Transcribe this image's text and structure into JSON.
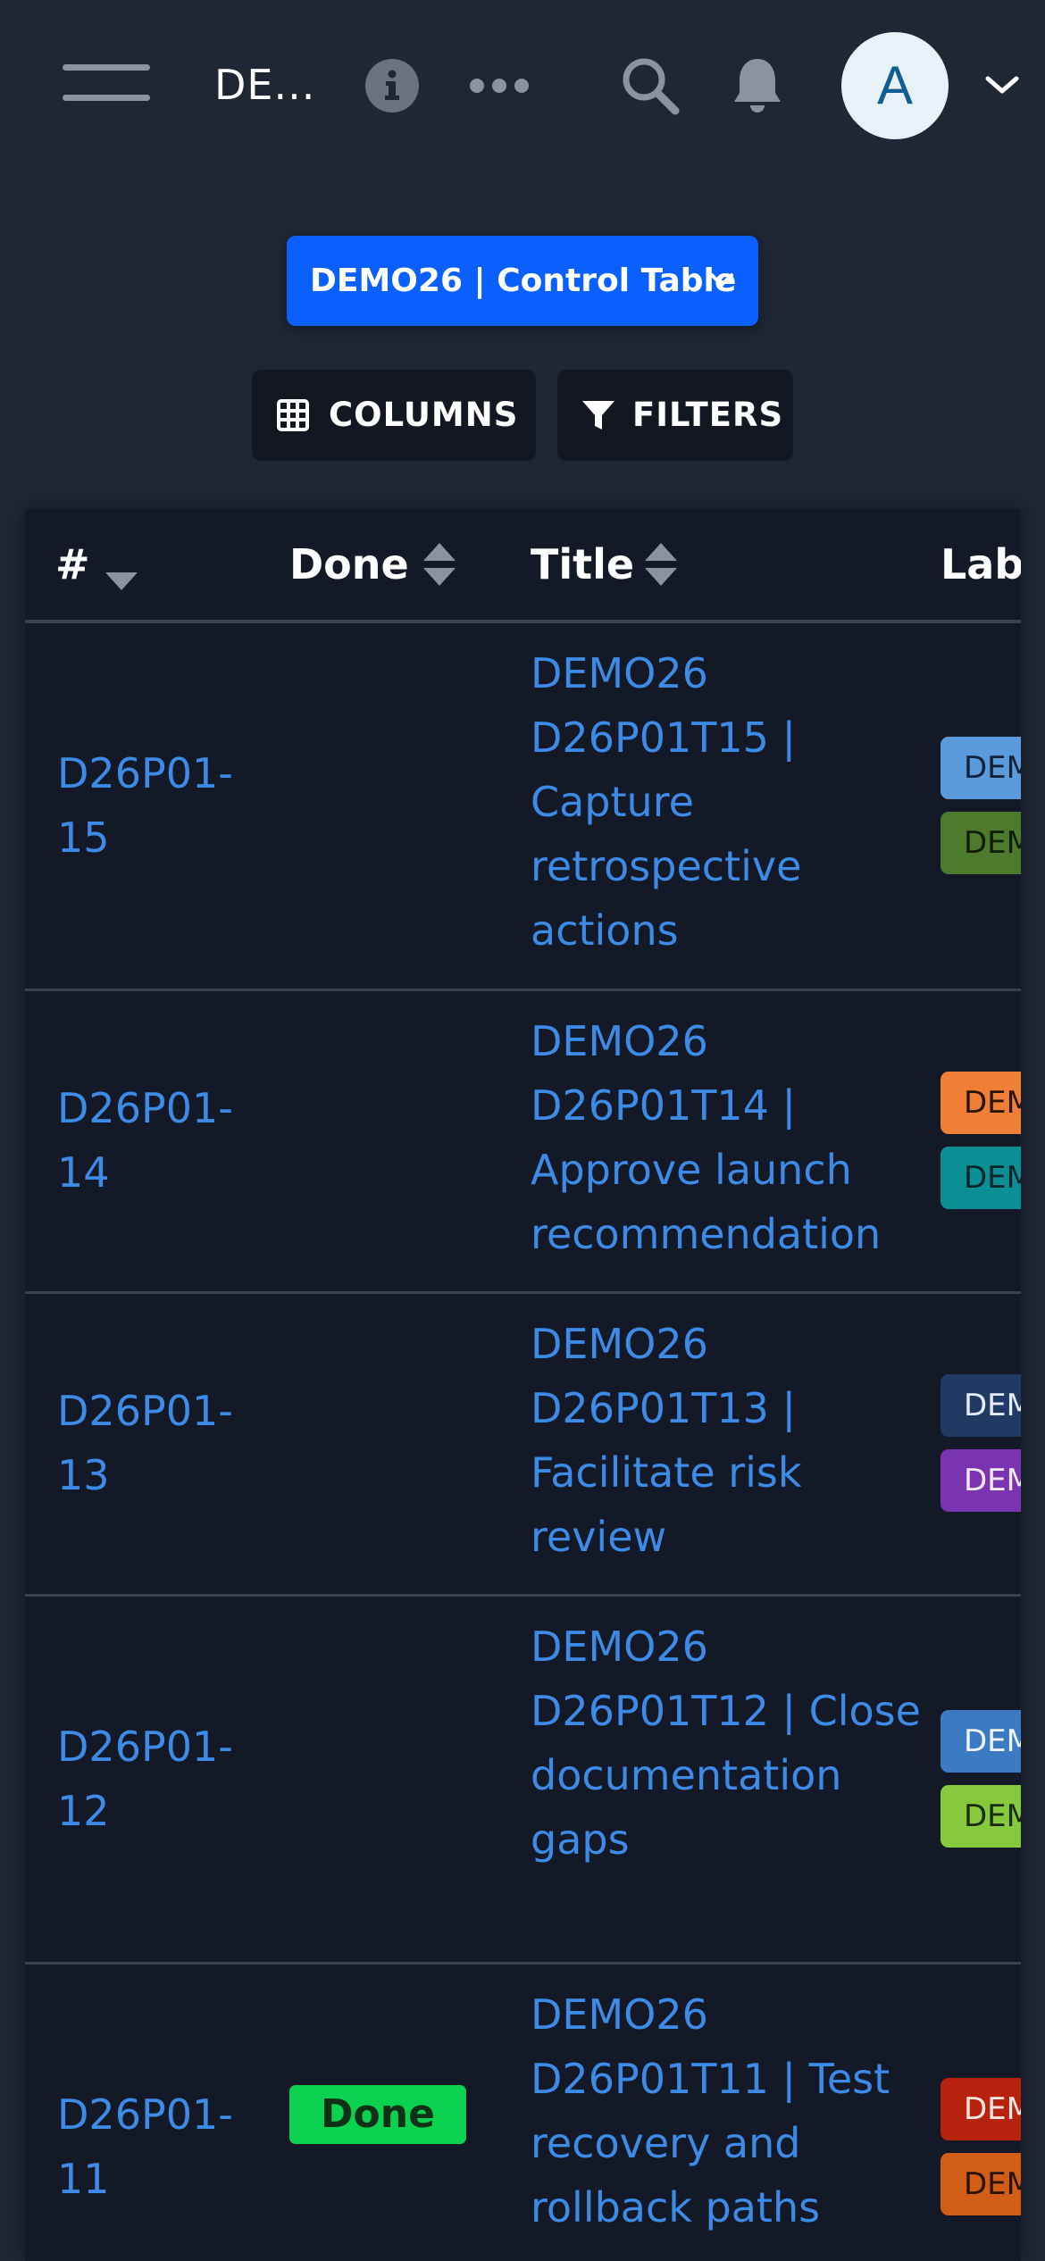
{
  "header": {
    "breadcrumb": "DE...",
    "avatar_initial": "A",
    "icons": [
      "menu-icon",
      "info-icon",
      "more-icon",
      "search-icon",
      "bell-icon",
      "chevron-down-icon"
    ]
  },
  "view_selector": {
    "label": "DEMO26 | Control Table"
  },
  "toolbar": {
    "columns_label": "COLUMNS",
    "filters_label": "FILTERS"
  },
  "table": {
    "columns": {
      "id": "#",
      "done": "Done",
      "title": "Title",
      "labels": "Labe"
    },
    "rows": [
      {
        "id": "D26P01-15",
        "done": "",
        "title": "DEMO26 D26P01T15 | Capture retrospective actions",
        "labels": [
          {
            "text": "DEMO",
            "color": "#5b9bdc",
            "fg": "#12203a"
          },
          {
            "text": "DEMO",
            "color": "#4e7a2d",
            "fg": "#0f1e06"
          }
        ]
      },
      {
        "id": "D26P01-14",
        "done": "",
        "title": "DEMO26 D26P01T14 | Approve launch recommendation",
        "labels": [
          {
            "text": "DEMO",
            "color": "#ef7f34",
            "fg": "#2a1406"
          },
          {
            "text": "DEMO",
            "color": "#0b8f95",
            "fg": "#04262a"
          }
        ]
      },
      {
        "id": "D26P01-13",
        "done": "",
        "title": "DEMO26 D26P01T13 | Facilitate risk review",
        "labels": [
          {
            "text": "DEMO",
            "color": "#213a63",
            "fg": "#e4ecf9"
          },
          {
            "text": "DEMO",
            "color": "#7b34b1",
            "fg": "#f3e8fb"
          }
        ]
      },
      {
        "id": "D26P01-12",
        "done": "",
        "title": "DEMO26 D26P01T12 | Close documentation gaps",
        "labels": [
          {
            "text": "DEMO",
            "color": "#3c7bc4",
            "fg": "#eef4fb"
          },
          {
            "text": "DEMO",
            "color": "#86c93c",
            "fg": "#1b2c08"
          }
        ]
      },
      {
        "id": "D26P01-11",
        "done": "Done",
        "title": "DEMO26 D26P01T11 | Test recovery and rollback paths",
        "labels": [
          {
            "text": "DEMO",
            "color": "#b7230f",
            "fg": "#fbe5e1"
          },
          {
            "text": "DEMO",
            "color": "#d15d17",
            "fg": "#2a1204"
          }
        ]
      }
    ]
  }
}
